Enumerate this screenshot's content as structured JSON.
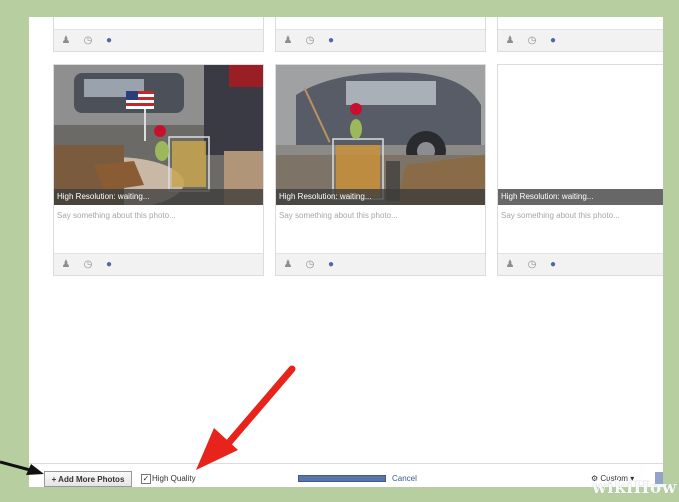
{
  "photo_cards": [
    {
      "status": "High Resolution: waiting...",
      "caption_placeholder": "Say something about this photo..."
    },
    {
      "status": "High Resolution: waiting...",
      "caption_placeholder": "Say something about this photo..."
    },
    {
      "status": "High Resolution: waiting...",
      "caption_placeholder": "Say something about this photo..."
    }
  ],
  "toolbar_icons": [
    "tag-person-icon",
    "clock-icon",
    "location-pin-icon"
  ],
  "footer": {
    "add_more_label": "+ Add More Photos",
    "high_quality_label": "High Quality",
    "high_quality_checked_mark": "✓",
    "upload_progress": 1.0,
    "cancel_label": "Cancel",
    "privacy_label": "Custom",
    "privacy_caret": "▾"
  },
  "watermark": "wikiHow",
  "colors": {
    "frame": "#b7cfa0",
    "progress": "#5b74a8",
    "link": "#3b5998",
    "annotation_arrow": "#e8231b"
  }
}
